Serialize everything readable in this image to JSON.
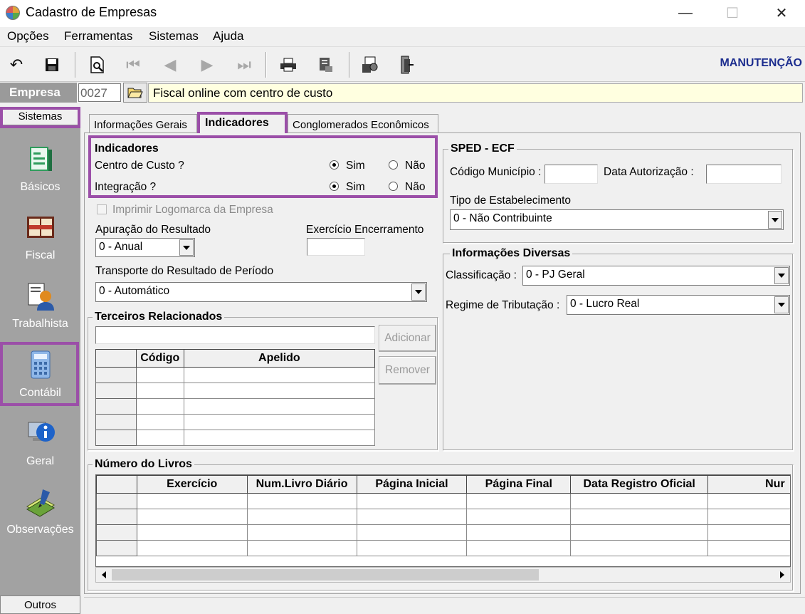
{
  "window": {
    "title": "Cadastro de Empresas",
    "controls": [
      "—",
      "☐",
      "✕"
    ]
  },
  "menu": [
    "Opções",
    "Ferramentas",
    "Sistemas",
    "Ajuda"
  ],
  "toolbar": {
    "mode": "MANUTENÇÃO",
    "icons": [
      "undo-icon",
      "save-icon",
      "preview-icon",
      "first-icon",
      "prev-icon",
      "next-icon",
      "last-icon",
      "print-icon",
      "report-icon",
      "config-icon",
      "exit-icon"
    ]
  },
  "empresa": {
    "label": "Empresa",
    "code": "0027",
    "name": "Fiscal online com centro de custo"
  },
  "sidebar": {
    "header": "Sistemas",
    "items": [
      {
        "label": "Básicos",
        "icon": "book-icon"
      },
      {
        "label": "Fiscal",
        "icon": "ledger-icon"
      },
      {
        "label": "Trabalhista",
        "icon": "worker-icon"
      },
      {
        "label": "Contábil",
        "icon": "calculator-icon"
      },
      {
        "label": "Geral",
        "icon": "info-icon"
      },
      {
        "label": "Observações",
        "icon": "notes-icon"
      }
    ],
    "footer": "Outros"
  },
  "tabs": [
    {
      "label": "Informações Gerais",
      "active": false
    },
    {
      "label": "Indicadores",
      "active": true
    },
    {
      "label": "Conglomerados Econômicos",
      "active": false
    }
  ],
  "indicadores": {
    "title": "Indicadores",
    "centro_label": "Centro de Custo ?",
    "integracao_label": "Integração ?",
    "sim": "Sim",
    "nao": "Não",
    "centro_value": "Sim",
    "integracao_value": "Sim"
  },
  "imprimir_logo": "Imprimir Logomarca da Empresa",
  "apuracao": {
    "label": "Apuração do Resultado",
    "value": "0 - Anual"
  },
  "exercicio": {
    "label": "Exercício Encerramento",
    "value": ""
  },
  "transporte": {
    "label": "Transporte do Resultado de Período",
    "value": "0 - Automático"
  },
  "terceiros": {
    "title": "Terceiros Relacionados",
    "add": "Adicionar",
    "remove": "Remover",
    "columns": [
      "Código",
      "Apelido"
    ],
    "rows": 4
  },
  "sped": {
    "title": "SPED - ECF",
    "municipio_label": "Código Município :",
    "data_label": "Data Autorização :",
    "tipo_label": "Tipo de Estabelecimento",
    "tipo_value": "0 - Não Contribuinte"
  },
  "diversas": {
    "title": "Informações Diversas",
    "classificacao_label": "Classificação :",
    "classificacao_value": "0 - PJ Geral",
    "regime_label": "Regime de Tributação :",
    "regime_value": "0 - Lucro Real"
  },
  "livros": {
    "title": "Número do Livros",
    "columns": [
      "Exercício",
      "Num.Livro Diário",
      "Página Inicial",
      "Página Final",
      "Data Registro Oficial",
      "Nur"
    ],
    "rows": 4
  }
}
